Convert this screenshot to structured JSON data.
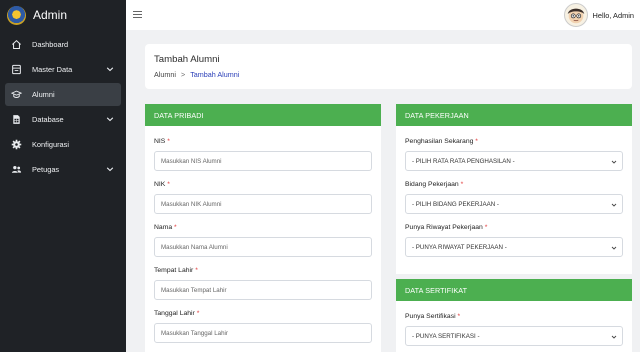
{
  "app": {
    "title": "Admin"
  },
  "topbar": {
    "greeting": "Hello, Admin"
  },
  "sidebar": {
    "items": [
      {
        "label": "Dashboard",
        "icon": "home-icon"
      },
      {
        "label": "Master Data",
        "icon": "database-icon"
      },
      {
        "label": "Alumni",
        "icon": "graduation-cap-icon",
        "active": true
      },
      {
        "label": "Database",
        "icon": "file-table-icon"
      },
      {
        "label": "Konfigurasi",
        "icon": "gear-icon"
      },
      {
        "label": "Petugas",
        "icon": "users-icon"
      }
    ]
  },
  "header": {
    "title": "Tambah Alumni",
    "breadcrumb": [
      "Alumni",
      "Tambah Alumni"
    ]
  },
  "pribadi": {
    "title": "DATA PRIBADI",
    "fields": [
      {
        "label": "NIS",
        "placeholder": "Masukkan NIS Alumni"
      },
      {
        "label": "NIK",
        "placeholder": "Masukkan NIK Alumni"
      },
      {
        "label": "Nama",
        "placeholder": "Masukkan Nama Alumni"
      },
      {
        "label": "Tempat Lahir",
        "placeholder": "Masukkan Tempat Lahir"
      },
      {
        "label": "Tanggal Lahir",
        "placeholder": "Masukkan Tanggal Lahir"
      }
    ]
  },
  "pekerjaan": {
    "title": "DATA PEKERJAAN",
    "fields": [
      {
        "label": "Penghasilan Sekarang",
        "value": "- PILIH RATA RATA PENGHASILAN -"
      },
      {
        "label": "Bidang Pekerjaan",
        "value": "- PILIH BIDANG PEKERJAAN -"
      },
      {
        "label": "Punya Riwayat Pekerjaan",
        "value": "- PUNYA RIWAYAT PEKERJAAN -"
      }
    ]
  },
  "sertifikat": {
    "title": "DATA SERTIFIKAT",
    "fields": [
      {
        "label": "Punya Sertifikasi",
        "value": "- PUNYA SERTIFIKASI -"
      }
    ]
  },
  "colors": {
    "sidebar": "#1f2226",
    "header_green": "#4caf50",
    "link": "#2a3fb8"
  }
}
